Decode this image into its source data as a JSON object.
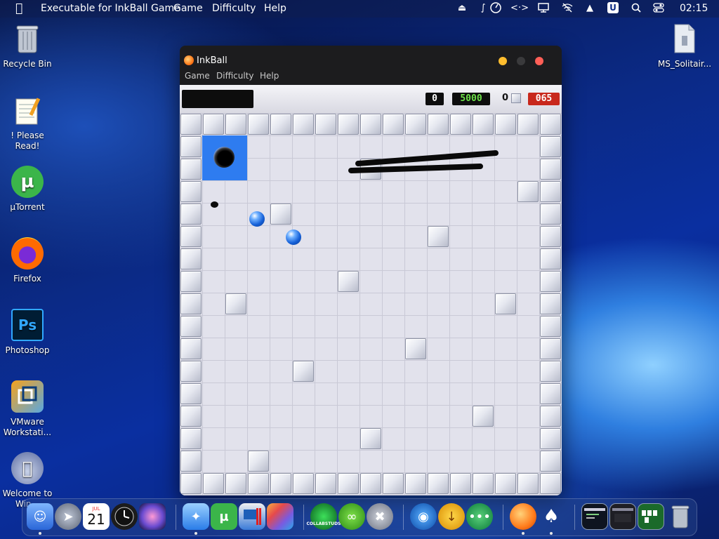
{
  "menubar": {
    "app_name": "Executable for InkBall Game",
    "items": [
      "Game",
      "Difficulty",
      "Help"
    ],
    "clock": "02:15",
    "status_u_label": "U"
  },
  "desktop": {
    "icons": [
      {
        "label": "Recycle Bin"
      },
      {
        "label": "! Please Read!"
      },
      {
        "label": "µTorrent"
      },
      {
        "label": "Firefox"
      },
      {
        "label": "Photoshop",
        "art_text": "Ps"
      },
      {
        "label": "VMware Workstati..."
      },
      {
        "label": "Welcome to Win..."
      },
      {
        "label": "MS_Solitair..."
      }
    ]
  },
  "window": {
    "title": "InkBall",
    "menu": [
      "Game",
      "Difficulty",
      "Help"
    ],
    "score": {
      "current": "0",
      "time_bonus": "5000",
      "balls_remaining": "0",
      "timer": "065"
    }
  },
  "dock": {
    "calendar_month": "JUL",
    "calendar_day": "21",
    "collabstudio_label": "COLLABSTUDS"
  },
  "colors": {
    "hole_blue": "#2e7cf0",
    "ball_blue": "#1560d8",
    "timer_red": "#c8281c",
    "lcd_green": "#6ee24a"
  }
}
